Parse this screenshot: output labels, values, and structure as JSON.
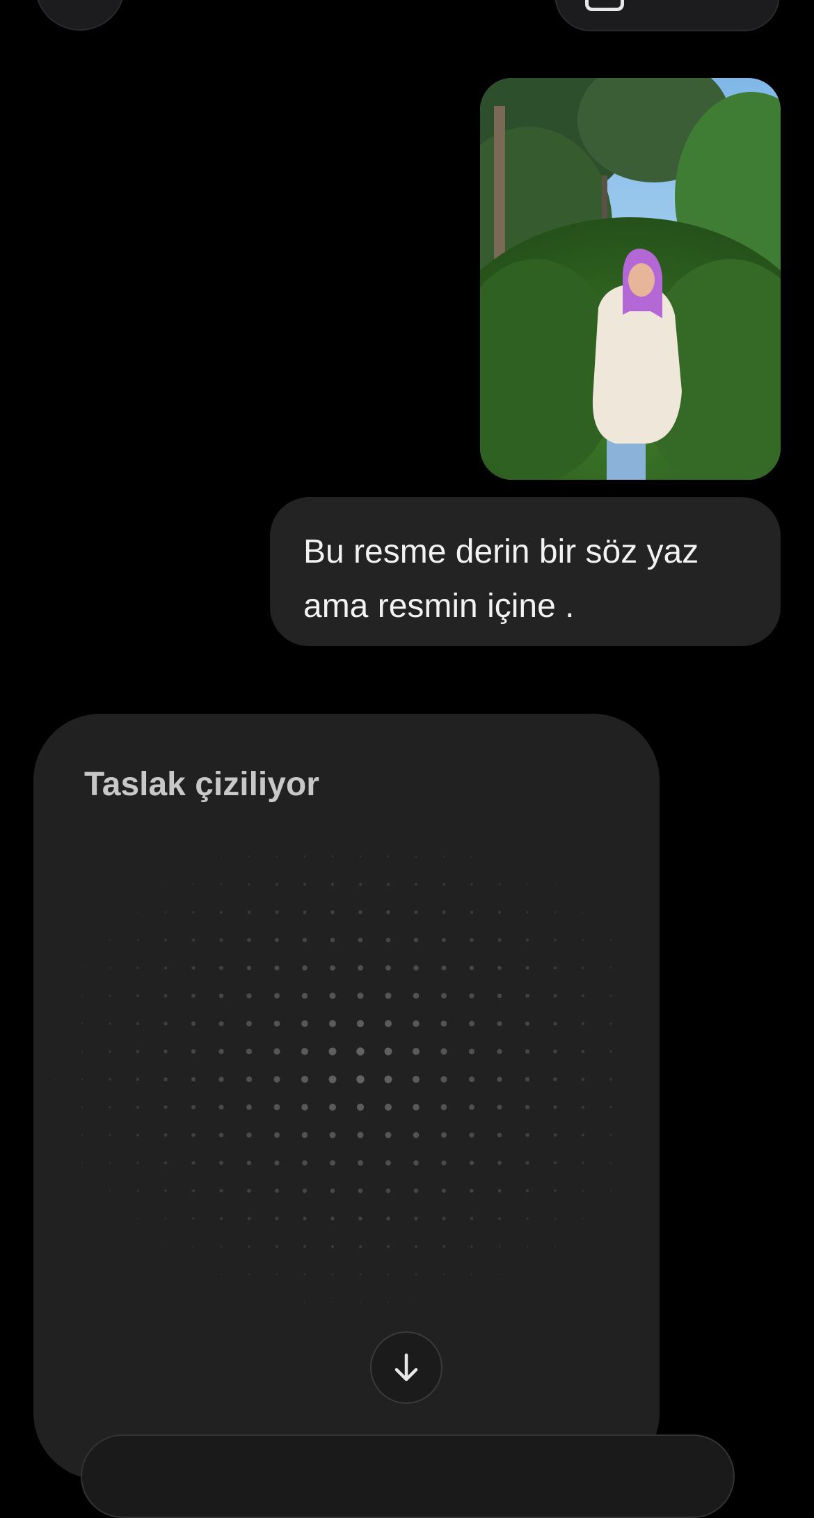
{
  "message": {
    "line1": "Bu resme derin bir söz yaz",
    "line2": "ama resmin içine ."
  },
  "draft": {
    "title": "Taslak çiziliyor"
  },
  "icons": {
    "scroll_down": "arrow-down-icon",
    "top_right": "tray-icon"
  },
  "colors": {
    "background": "#000000",
    "bubble": "#232323",
    "card": "#212121",
    "text": "#f2f2f2",
    "title": "#c8c8c8"
  }
}
